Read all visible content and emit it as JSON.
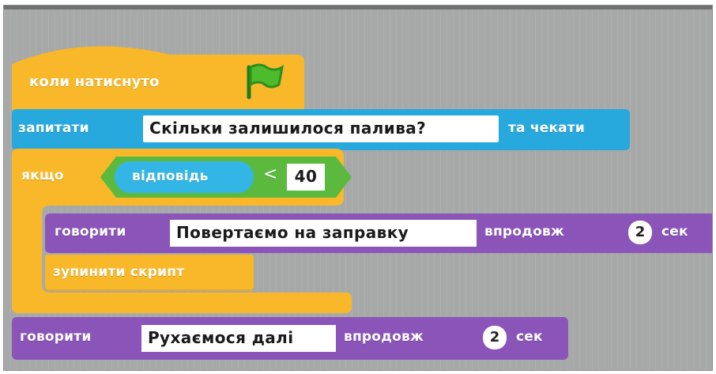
{
  "blocks": {
    "hat": {
      "label": "коли натиснуто",
      "icon": "green-flag-icon"
    },
    "ask": {
      "label": "запитати",
      "text": "Скільки залишилося палива?",
      "suffix": "та чекати"
    },
    "if": {
      "label": "якщо",
      "reporter": "відповідь",
      "operator": "<",
      "value": "40"
    },
    "say_inner": {
      "label": "говорити",
      "text": "Повертаємо на заправку",
      "mid": "впродовж",
      "num": "2",
      "unit": "сек"
    },
    "stop": {
      "label": "зупинити скрипт"
    },
    "say_outer": {
      "label": "говорити",
      "text": "Рухаємося далі",
      "mid": "впродовж",
      "num": "2",
      "unit": "сек"
    }
  },
  "colors": {
    "events": "#f8b829",
    "sensing": "#27a9dd",
    "sensing_reporter": "#33b6e6",
    "looks": "#8a54b9",
    "control": "#f8b829",
    "operators": "#5bba3e",
    "stage_bg": "#a7a8a8"
  }
}
